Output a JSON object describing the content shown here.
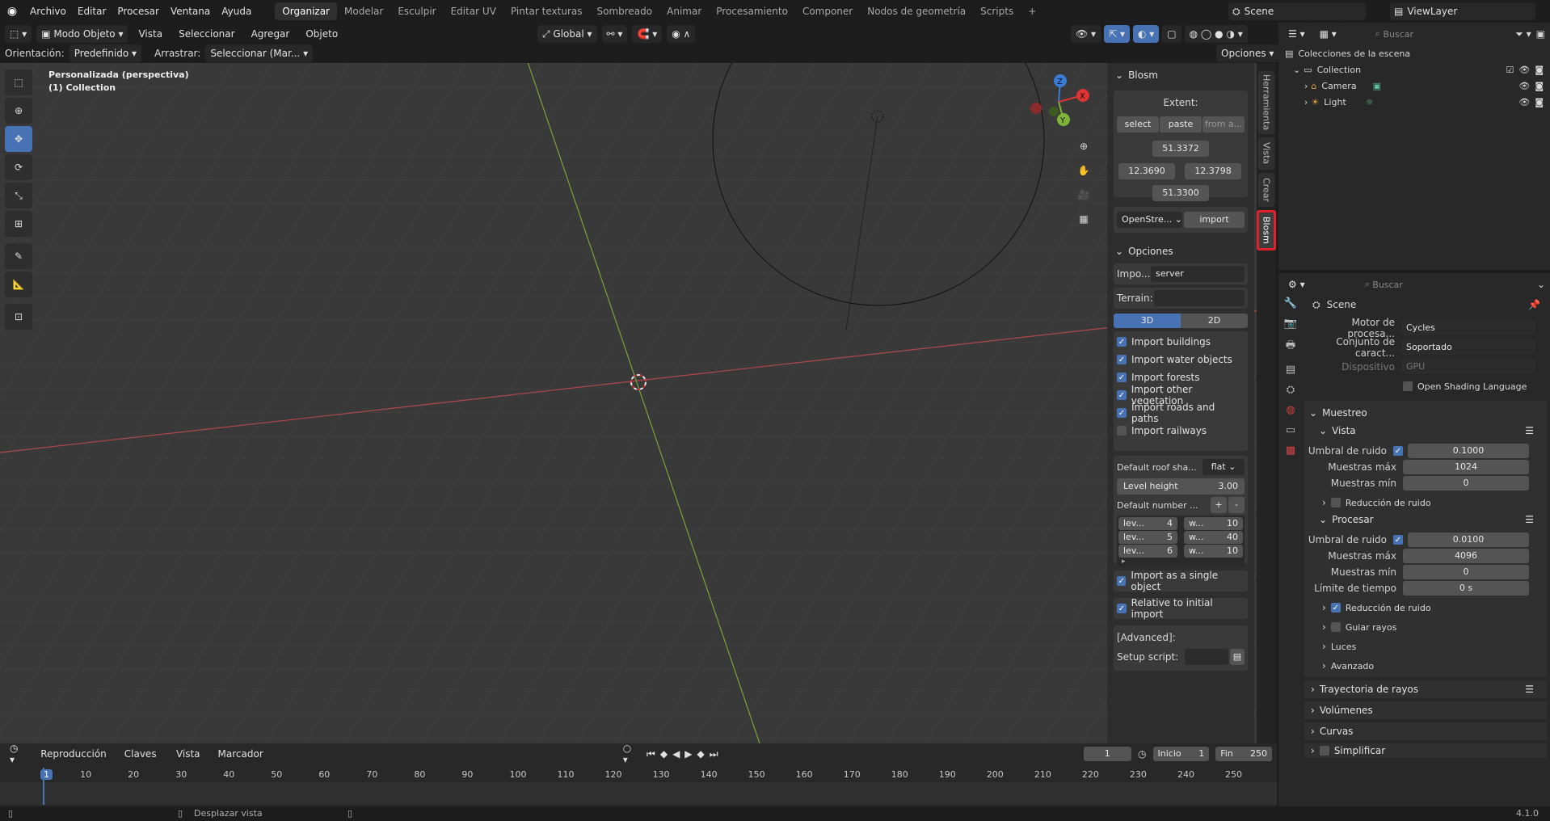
{
  "topbar": {
    "menus": [
      "Archivo",
      "Editar",
      "Procesar",
      "Ventana",
      "Ayuda"
    ],
    "workspaces": [
      "Organizar",
      "Modelar",
      "Esculpir",
      "Editar UV",
      "Pintar texturas",
      "Sombreado",
      "Animar",
      "Procesamiento",
      "Componer",
      "Nodos de geometría",
      "Scripts"
    ],
    "active_workspace": "Organizar",
    "scene_name": "Scene",
    "view_layer": "ViewLayer"
  },
  "viewport_header": {
    "mode": "Modo Objeto",
    "menus": [
      "Vista",
      "Seleccionar",
      "Agregar",
      "Objeto"
    ],
    "transform_orientation": "Global",
    "orientation_label": "Orientación:",
    "orientation_value": "Predefinido",
    "drag_label": "Arrastrar:",
    "drag_value": "Seleccionar (Mar...",
    "options": "Opciones"
  },
  "viewport": {
    "view_name": "Personalizada (perspectiva)",
    "collection": "(1) Collection",
    "gizmo": {
      "x": "X",
      "y": "Y",
      "z": "Z"
    },
    "colors": {
      "grid_bg": "#393939",
      "x_axis": "#c44a4a",
      "y_axis": "#8ab33a"
    }
  },
  "npanel": {
    "title": "Blosm",
    "extent_label": "Extent:",
    "extent_buttons": [
      "select",
      "paste",
      "from a..."
    ],
    "extent_values": {
      "top": "51.3372",
      "left": "12.3690",
      "right": "12.3798",
      "bottom": "51.3300"
    },
    "source": "OpenStre...",
    "import_btn": "import",
    "options_title": "Opciones",
    "import_label": "Impo...",
    "import_value": "server",
    "terrain_label": "Terrain:",
    "mode_3d": "3D",
    "mode_2d": "2D",
    "checks": [
      {
        "label": "Import buildings",
        "checked": true
      },
      {
        "label": "Import water objects",
        "checked": true
      },
      {
        "label": "Import forests",
        "checked": true
      },
      {
        "label": "Import other vegetation",
        "checked": true
      },
      {
        "label": "Import roads and paths",
        "checked": true
      },
      {
        "label": "Import railways",
        "checked": false
      }
    ],
    "roof_label": "Default roof sha...",
    "roof_value": "flat",
    "level_height_label": "Level height",
    "level_height_value": "3.00",
    "default_number_label": "Default number ...",
    "plus": "+",
    "minus": "-",
    "levels": [
      {
        "lev": "lev...",
        "lv": "4",
        "w": "w...",
        "wv": "10"
      },
      {
        "lev": "lev...",
        "lv": "5",
        "w": "w...",
        "wv": "40"
      },
      {
        "lev": "lev...",
        "lv": "6",
        "w": "w...",
        "wv": "10"
      }
    ],
    "single_object": "Import as a single object",
    "relative": "Relative to initial import",
    "advanced": "[Advanced]:",
    "setup_script": "Setup script:"
  },
  "vtabs": [
    "Herramienta",
    "Vista",
    "Crear",
    "Blosm"
  ],
  "outliner": {
    "search_placeholder": "Buscar",
    "root": "Colecciones de la escena",
    "collection": "Collection",
    "items": [
      "Camera",
      "Light"
    ]
  },
  "properties": {
    "search_placeholder": "Buscar",
    "scene": "Scene",
    "engine_label": "Motor de procesa...",
    "engine_value": "Cycles",
    "featureset_label": "Conjunto de caract...",
    "featureset_value": "Soportado",
    "device_label": "Dispositivo",
    "device_value": "GPU",
    "osl": "Open Shading Language",
    "sampling": "Muestreo",
    "viewport_sub": "Vista",
    "noise_threshold_label": "Umbral de ruido",
    "vp_noise": "0.1000",
    "max_samples_label": "Muestras máx",
    "vp_max": "1024",
    "min_samples_label": "Muestras mín",
    "vp_min": "0",
    "denoise": "Reducción de ruido",
    "render_sub": "Procesar",
    "r_noise": "0.0100",
    "r_max": "4096",
    "r_min": "0",
    "time_limit_label": "Límite de tiempo",
    "r_time": "0 s",
    "guide": "Guiar rayos",
    "lights": "Luces",
    "advanced": "Avanzado",
    "light_paths": "Trayectoria de rayos",
    "volumes": "Volúmenes",
    "curves": "Curvas",
    "simplify": "Simplificar"
  },
  "timeline": {
    "menus": [
      "Reproducción",
      "Claves",
      "Vista",
      "Marcador"
    ],
    "current_frame": "1",
    "start_label": "Inicio",
    "start": "1",
    "end_label": "Fin",
    "end": "250",
    "ticks": [
      "1",
      "10",
      "20",
      "30",
      "40",
      "50",
      "60",
      "70",
      "80",
      "90",
      "100",
      "110",
      "120",
      "130",
      "140",
      "150",
      "160",
      "170",
      "180",
      "190",
      "200",
      "210",
      "220",
      "230",
      "240",
      "250"
    ]
  },
  "statusbar": {
    "hint": "Desplazar vista",
    "version": "4.1.0"
  }
}
